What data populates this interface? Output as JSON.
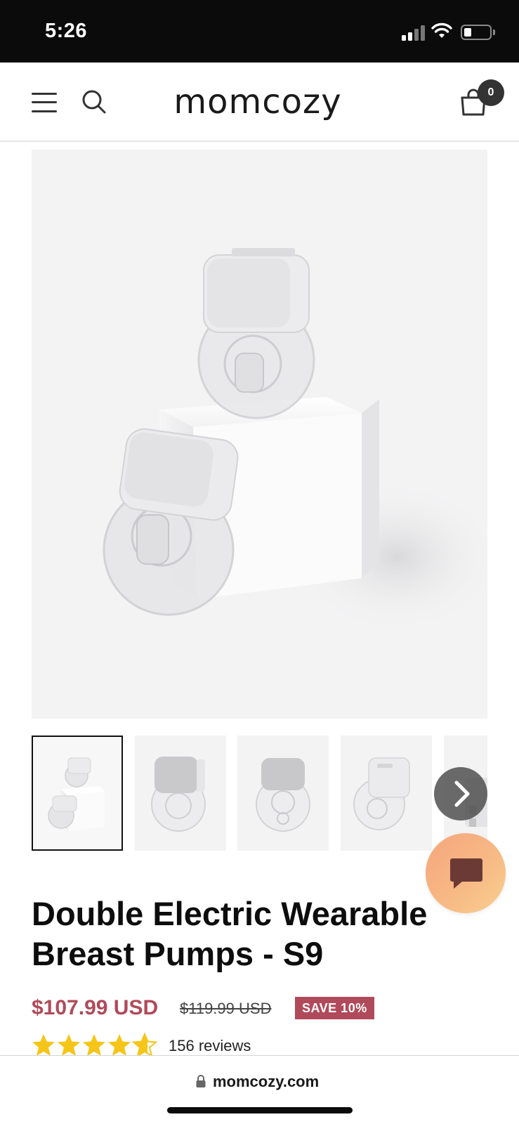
{
  "status_bar": {
    "time": "5:26"
  },
  "header": {
    "logo_text": "momcozy",
    "cart_count": "0"
  },
  "gallery": {
    "main_image_alt": "product-image-1",
    "thumbnails": [
      "thumbnail-1",
      "thumbnail-2",
      "thumbnail-3",
      "thumbnail-4",
      "thumbnail-5"
    ],
    "active_index": 0
  },
  "product": {
    "title": "Double Electric Wearable Breast Pumps - S9",
    "price": "$107.99 USD",
    "compare_price": "$119.99 USD",
    "save_label": "SAVE 10%",
    "rating": 4.6,
    "reviews_label": "156 reviews"
  },
  "browser": {
    "url": "momcozy.com"
  },
  "colors": {
    "accent": "#b04a5a",
    "star": "#f5c518",
    "chat_gradient_start": "#f6a57c",
    "chat_gradient_end": "#f8cf8e"
  }
}
